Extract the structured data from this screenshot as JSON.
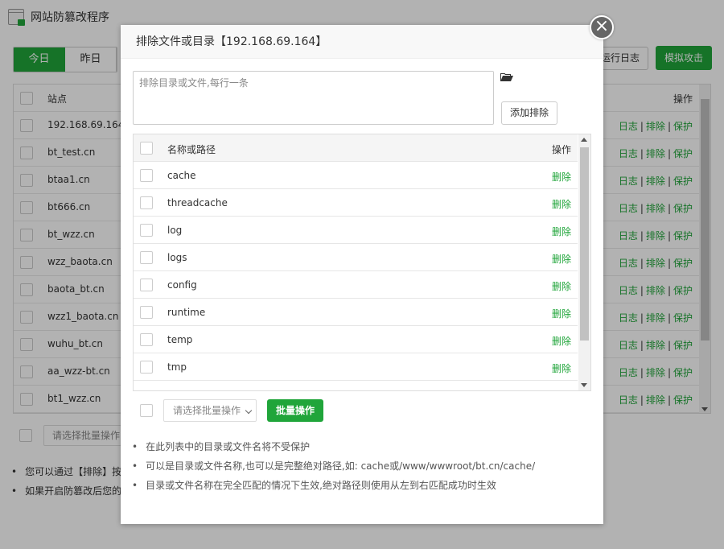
{
  "app": {
    "title": "网站防篡改程序"
  },
  "day_tabs": [
    "今日",
    "昨日"
  ],
  "header_buttons": {
    "run_log": "运行日志",
    "simulate_attack": "模拟攻击"
  },
  "site_table": {
    "columns": {
      "site": "站点",
      "actions": "操作"
    },
    "rows": [
      "192.168.69.164",
      "bt_test.cn",
      "btaa1.cn",
      "bt666.cn",
      "bt_wzz.cn",
      "wzz_baota.cn",
      "baota_bt.cn",
      "wzz1_baota.cn",
      "wuhu_bt.cn",
      "aa_wzz-bt.cn",
      "bt1_wzz.cn"
    ],
    "action_labels": {
      "log": "日志",
      "exclude": "排除",
      "protect": "保护"
    }
  },
  "bg_batch": {
    "select_placeholder": "请选择批量操作"
  },
  "bg_notes": [
    "您可以通过【排除】按",
    "如果开启防篡改后您的"
  ],
  "modal": {
    "title": "排除文件或目录【192.168.69.164】",
    "input_placeholder": "排除目录或文件,每行一条",
    "add_button": "添加排除",
    "columns": {
      "name": "名称或路径",
      "action": "操作"
    },
    "rows": [
      "cache",
      "threadcache",
      "log",
      "logs",
      "config",
      "runtime",
      "temp",
      "tmp"
    ],
    "delete_label": "删除",
    "batch_select": "请选择批量操作",
    "batch_button": "批量操作",
    "notes": [
      "在此列表中的目录或文件名将不受保护",
      "可以是目录或文件名称,也可以是完整绝对路径,如: cache或/www/wwwroot/bt.cn/cache/",
      "目录或文件名称在完全匹配的情况下生效,绝对路径则使用从左到右匹配成功时生效"
    ]
  },
  "colors": {
    "accent": "#20a53a",
    "overlay": "rgba(0,0,0,0.3)"
  }
}
